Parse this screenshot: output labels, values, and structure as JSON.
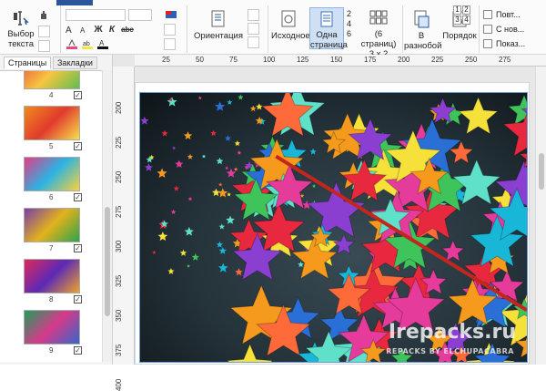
{
  "ribbon": {
    "select_text": {
      "line1": "Выбор",
      "line2": "текста"
    },
    "orientation": "Ориентация",
    "source": "Исходное",
    "one_page": {
      "line1": "Одна",
      "line2": "страница"
    },
    "pages_2": "2",
    "pages_4": "4",
    "pages_6": "6",
    "six_pages": {
      "line1": "(6 страниц)",
      "line2": "3 x 2"
    },
    "mixed": {
      "line1": "В",
      "line2": "разнобой"
    },
    "order": "Порядок",
    "grid_nums": [
      "1",
      "2",
      "3",
      "4"
    ],
    "checks": [
      "Повт...",
      "С нов...",
      "Показ..."
    ],
    "fmt": {
      "bold": "Ж",
      "italic": "К",
      "strike": "abc"
    },
    "accent": "#2b579a"
  },
  "panel": {
    "tabs": [
      "Страницы",
      "Закладки"
    ],
    "thumbs": [
      {
        "num": "4",
        "checked": "✓",
        "colors": [
          "#e94e3b",
          "#f7c541",
          "#5fbf4e"
        ]
      },
      {
        "num": "5",
        "checked": "✓",
        "colors": [
          "#f08a1c",
          "#e13b2d",
          "#f7e04a"
        ]
      },
      {
        "num": "6",
        "checked": "✓",
        "colors": [
          "#e63b86",
          "#2bb3e3",
          "#f8d13a"
        ]
      },
      {
        "num": "7",
        "checked": "✓",
        "colors": [
          "#7a3ea8",
          "#e3b21c",
          "#2ea34a"
        ]
      },
      {
        "num": "8",
        "checked": "✓",
        "colors": [
          "#e0285a",
          "#5b2ab6",
          "#f0a22a"
        ]
      },
      {
        "num": "9",
        "checked": "✓",
        "colors": [
          "#1f9e5b",
          "#d63a8a",
          "#3466c9"
        ]
      }
    ]
  },
  "rulers": {
    "h": [
      "25",
      "50",
      "75",
      "100",
      "125",
      "150",
      "175",
      "200",
      "225",
      "250",
      "275"
    ],
    "v": [
      "200",
      "225",
      "250",
      "275",
      "300",
      "325",
      "350",
      "375",
      "400"
    ]
  },
  "watermark": {
    "main": "Irepacks.ru",
    "sub": "REPACKS BY ELCHUPACABRA"
  }
}
